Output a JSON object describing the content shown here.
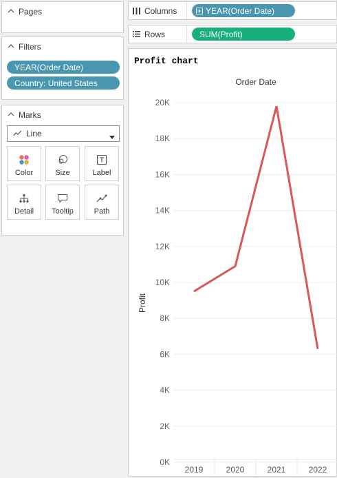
{
  "pages": {
    "title": "Pages"
  },
  "filters": {
    "title": "Filters",
    "pills": [
      "YEAR(Order Date)",
      "Country: United States"
    ]
  },
  "marks": {
    "title": "Marks",
    "mark_type": "Line",
    "buttons": [
      "Color",
      "Size",
      "Label",
      "Detail",
      "Tooltip",
      "Path"
    ]
  },
  "columns": {
    "label": "Columns",
    "pill": "YEAR(Order Date)"
  },
  "rows": {
    "label": "Rows",
    "pill": "SUM(Profit)"
  },
  "sheet": {
    "title": "Profit chart"
  },
  "colors": {
    "pill_blue": "#4896b0",
    "pill_green": "#17b07a",
    "line": "#d9575a"
  },
  "chart_data": {
    "type": "line",
    "title": "Profit chart",
    "xlabel": "Order Date",
    "ylabel": "Profit",
    "categories": [
      "2019",
      "2020",
      "2021",
      "2022"
    ],
    "series": [
      {
        "values": [
          9500,
          10900,
          19800,
          6300
        ]
      }
    ],
    "ylim": [
      0,
      20000
    ],
    "yticks": [
      0,
      2000,
      4000,
      6000,
      8000,
      10000,
      12000,
      14000,
      16000,
      18000,
      20000
    ],
    "ytick_labels": [
      "0K",
      "2K",
      "4K",
      "6K",
      "8K",
      "10K",
      "12K",
      "14K",
      "16K",
      "18K",
      "20K"
    ],
    "grid": true,
    "legend": "none"
  }
}
